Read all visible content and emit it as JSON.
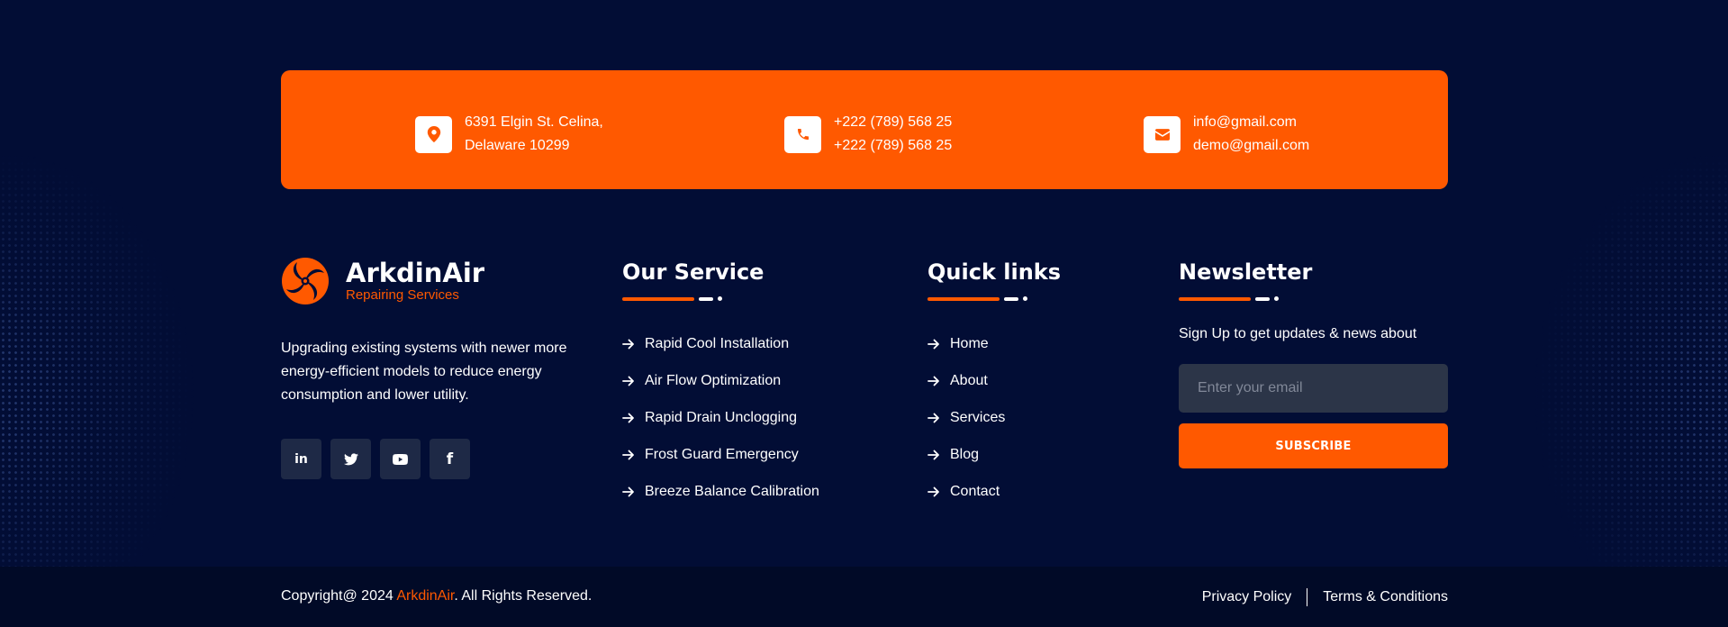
{
  "contact": {
    "address": [
      "6391 Elgin St. Celina,",
      "Delaware 10299"
    ],
    "phones": [
      "+222 (789) 568 25",
      "+222 (789) 568 25"
    ],
    "emails": [
      "info@gmail.com",
      "demo@gmail.com"
    ]
  },
  "brand": {
    "name": "ArkdinAir",
    "tagline": "Repairing Services",
    "description": "Upgrading existing systems with newer more energy-efficient models to reduce energy consumption and lower utility.",
    "socials": [
      {
        "icon": "linkedin-icon",
        "glyph": "in"
      },
      {
        "icon": "twitter-icon",
        "glyph": ""
      },
      {
        "icon": "youtube-icon",
        "glyph": ""
      },
      {
        "icon": "facebook-icon",
        "glyph": "f"
      }
    ]
  },
  "service": {
    "title": "Our Service",
    "items": [
      "Rapid Cool Installation",
      "Air Flow Optimization",
      "Rapid Drain Unclogging",
      "Frost Guard Emergency",
      "Breeze Balance Calibration"
    ]
  },
  "quick": {
    "title": "Quick links",
    "items": [
      "Home",
      "About",
      "Services",
      "Blog",
      "Contact"
    ]
  },
  "newsletter": {
    "title": "Newsletter",
    "text": "Sign Up to get updates & news about",
    "placeholder": "Enter your email",
    "button": "SUBSCRIBE"
  },
  "footer": {
    "copyright_prefix": "Copyright@ 2024 ",
    "copyright_brand": "ArkdinAir",
    "copyright_suffix": ". All Rights Reserved.",
    "privacy": "Privacy Policy",
    "terms": "Terms & Conditions"
  },
  "colors": {
    "background": "#020d35",
    "accent": "#ff5900",
    "social_bg": "#1e2946",
    "input_bg": "#2c3548",
    "bottom_bar": "#010a27"
  }
}
